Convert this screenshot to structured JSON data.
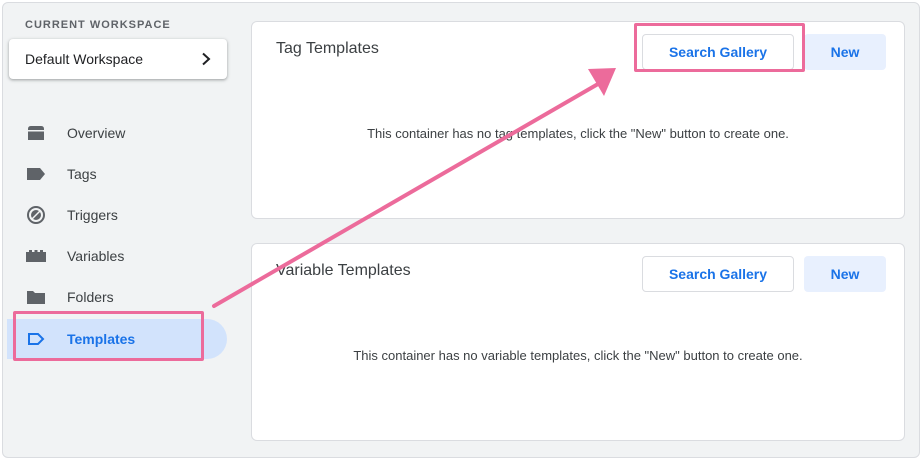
{
  "sidebar": {
    "workspace_label": "CURRENT WORKSPACE",
    "workspace_name": "Default Workspace",
    "items": [
      {
        "label": "Overview",
        "icon": "overview-icon"
      },
      {
        "label": "Tags",
        "icon": "tag-icon"
      },
      {
        "label": "Triggers",
        "icon": "trigger-icon"
      },
      {
        "label": "Variables",
        "icon": "variables-icon"
      },
      {
        "label": "Folders",
        "icon": "folder-icon"
      },
      {
        "label": "Templates",
        "icon": "template-icon",
        "active": true
      }
    ]
  },
  "tag_templates": {
    "title": "Tag Templates",
    "gallery_label": "Search Gallery",
    "new_label": "New",
    "empty_message": "This container has no tag templates, click the \"New\" button to create one."
  },
  "variable_templates": {
    "title": "Variable Templates",
    "gallery_label": "Search Gallery",
    "new_label": "New",
    "empty_message": "This container has no variable templates, click the \"New\" button to create one."
  },
  "colors": {
    "accent": "#1a73e8",
    "active_bg": "#d2e3fc",
    "annotation": "#ec6b9b"
  }
}
